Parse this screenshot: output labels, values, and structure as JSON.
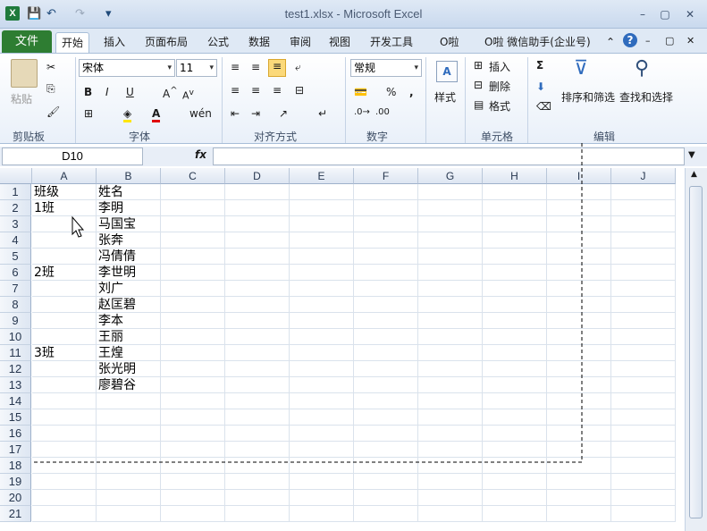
{
  "title": "test1.xlsx  -  Microsoft Excel",
  "app_icon": "X",
  "qat": {
    "save_icon": "💾",
    "undo_icon": "↶",
    "redo_icon": "↷",
    "customize_icon": "▾"
  },
  "window_buttons": {
    "minimize": "–",
    "restore": "▢",
    "close": "✕"
  },
  "tabs": {
    "file": "文件",
    "home": "开始",
    "insert": "插入",
    "page_layout": "页面布局",
    "formulas": "公式",
    "data": "数据",
    "review": "审阅",
    "view": "视图",
    "developer": "开发工具",
    "olah": "O啦",
    "wechat": "O啦 微信助手(企业号)"
  },
  "ribbon": {
    "clipboard": {
      "label": "剪贴板",
      "paste": "粘贴"
    },
    "font": {
      "label": "字体",
      "name": "宋体",
      "size": "11",
      "bold": "B",
      "italic": "I",
      "underline": "U"
    },
    "alignment": {
      "label": "对齐方式"
    },
    "number": {
      "label": "数字",
      "format": "常规",
      "percent": "%",
      "comma": ","
    },
    "styles": {
      "label": "样式"
    },
    "cells": {
      "label": "单元格",
      "insert": "插入",
      "delete": "删除",
      "format": "格式"
    },
    "editing": {
      "label": "编辑",
      "sort_filter": "排序和筛选",
      "find_select": "查找和选择",
      "sum": "Σ"
    }
  },
  "formula_bar": {
    "name_box": "D10",
    "fx": "fx",
    "value": ""
  },
  "columns": [
    "A",
    "B",
    "C",
    "D",
    "E",
    "F",
    "G",
    "H",
    "I",
    "J"
  ],
  "rows": [
    {
      "n": "1",
      "a": "班级",
      "b": "姓名"
    },
    {
      "n": "2",
      "a": "1班",
      "b": "李明"
    },
    {
      "n": "3",
      "a": "",
      "b": "马国宝"
    },
    {
      "n": "4",
      "a": "",
      "b": "张奔"
    },
    {
      "n": "5",
      "a": "",
      "b": "冯倩倩"
    },
    {
      "n": "6",
      "a": "2班",
      "b": "李世明"
    },
    {
      "n": "7",
      "a": "",
      "b": "刘广"
    },
    {
      "n": "8",
      "a": "",
      "b": "赵匡碧"
    },
    {
      "n": "9",
      "a": "",
      "b": "李本"
    },
    {
      "n": "10",
      "a": "",
      "b": "王丽"
    },
    {
      "n": "11",
      "a": "3班",
      "b": "王煌"
    },
    {
      "n": "12",
      "a": "",
      "b": "张光明"
    },
    {
      "n": "13",
      "a": "",
      "b": "廖碧谷"
    },
    {
      "n": "14",
      "a": "",
      "b": ""
    },
    {
      "n": "15",
      "a": "",
      "b": ""
    },
    {
      "n": "16",
      "a": "",
      "b": ""
    },
    {
      "n": "17",
      "a": "",
      "b": ""
    },
    {
      "n": "18",
      "a": "",
      "b": ""
    },
    {
      "n": "19",
      "a": "",
      "b": ""
    },
    {
      "n": "20",
      "a": "",
      "b": ""
    },
    {
      "n": "21",
      "a": "",
      "b": ""
    }
  ]
}
